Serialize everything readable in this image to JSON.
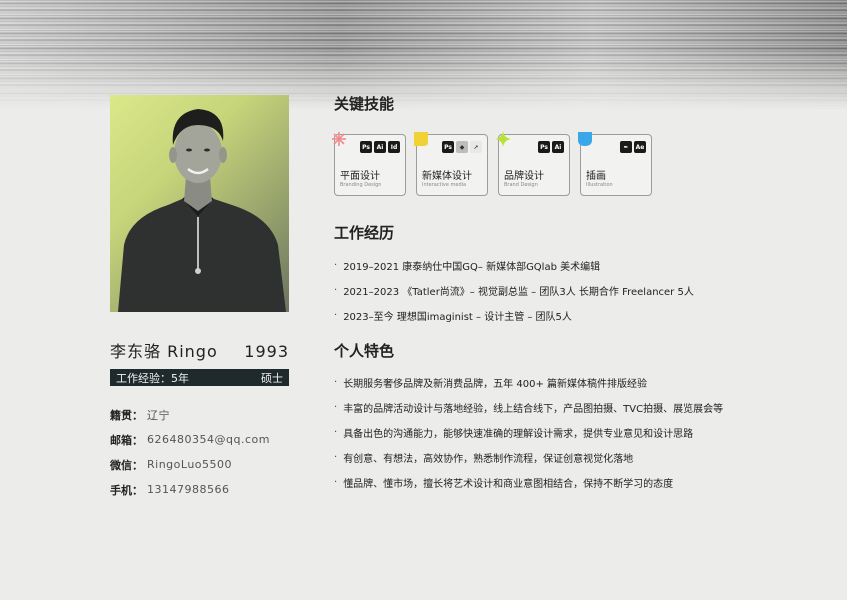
{
  "profile": {
    "name": "李东骆 Ringo",
    "birth_year": "1993",
    "experience": "工作经验：5年",
    "degree": "硕士",
    "info": [
      {
        "label": "籍贯：",
        "value": "辽宁"
      },
      {
        "label": "邮箱：",
        "value": "626480354@qq.com"
      },
      {
        "label": "微信：",
        "value": "RingoLuo5500"
      },
      {
        "label": "手机：",
        "value": "13147988566"
      }
    ]
  },
  "sections": {
    "skills_title": "关键技能",
    "experience_title": "工作经历",
    "traits_title": "个人特色"
  },
  "skills": [
    {
      "name": "平面设计",
      "sub": "Branding Design",
      "accent": "#f28b8b",
      "tools": [
        "Ps",
        "Ai",
        "Id"
      ]
    },
    {
      "name": "新媒体设计",
      "sub": "Interactive media",
      "accent": "#f0d234",
      "tools": [
        "Ps",
        "◆",
        "➚"
      ]
    },
    {
      "name": "品牌设计",
      "sub": "Brand Design",
      "accent": "#b7e23c",
      "tools": [
        "Ps",
        "Ai"
      ]
    },
    {
      "name": "插画",
      "sub": "Illustration",
      "accent": "#3aa8e8",
      "tools": [
        "✒",
        "Ae"
      ]
    }
  ],
  "experience": [
    "2019–2021  康泰纳仕中国GQ– 新媒体部GQlab  美术编辑",
    "2021–2023  《Tatler尚流》– 视觉副总监 – 团队3人 长期合作 Freelancer 5人",
    "2023–至今  理想国imaginist – 设计主管 – 团队5人"
  ],
  "traits": [
    "长期服务奢侈品牌及新消费品牌，五年 400+ 篇新媒体稿件排版经验",
    "丰富的品牌活动设计与落地经验，线上结合线下，产品图拍摄、TVC拍摄、展览展会等",
    "具备出色的沟通能力，能够快速准确的理解设计需求，提供专业意见和设计思路",
    "有创意、有想法，高效协作，熟悉制作流程，保证创意视觉化落地",
    "懂品牌、懂市场，擅长将艺术设计和商业意图相结合，保持不断学习的态度"
  ],
  "bullet": "·"
}
